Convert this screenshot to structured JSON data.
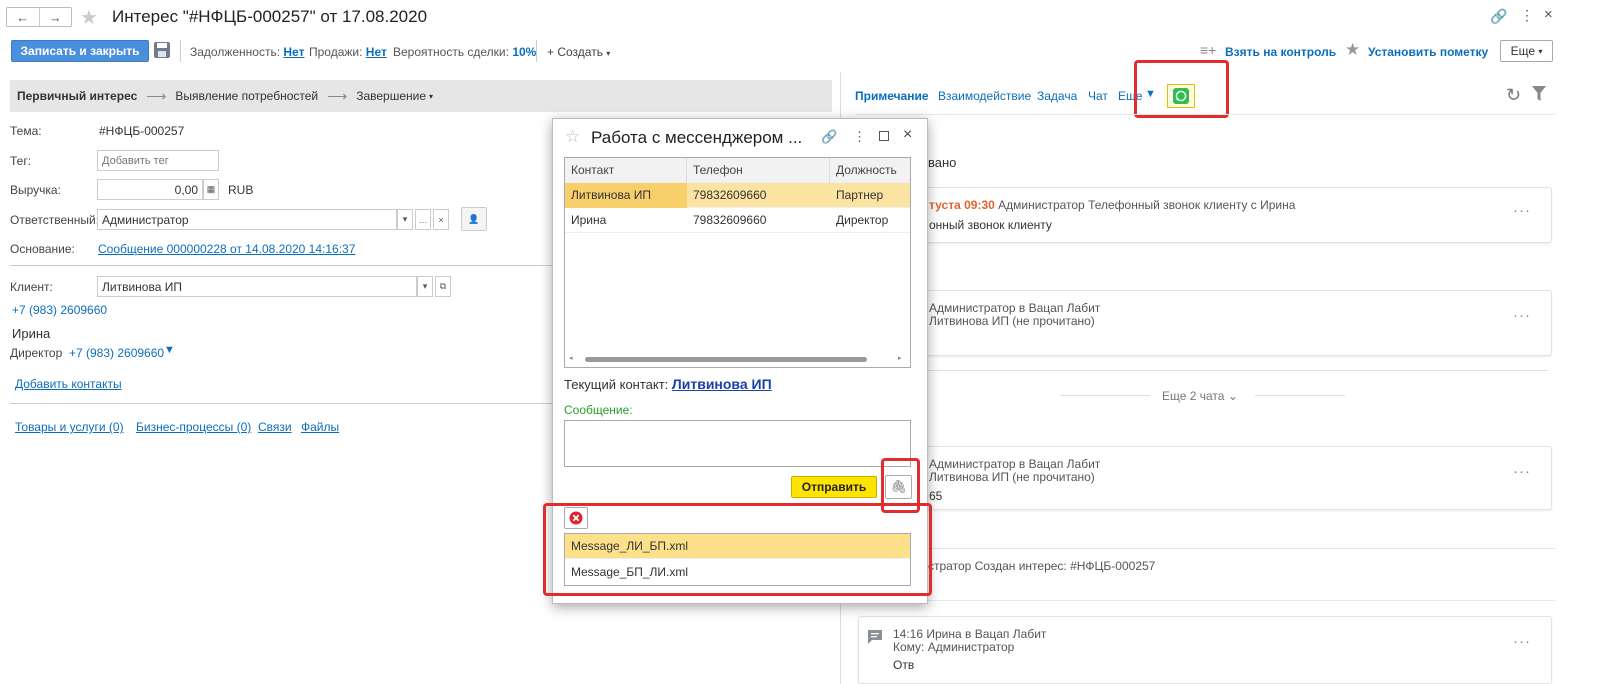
{
  "window": {
    "title": "Интерес \"#НФЦБ-000257\" от 17.08.2020"
  },
  "toolbar": {
    "save_close": "Записать и закрыть",
    "debt_label": "Задолженность:",
    "debt_value": "Нет",
    "sales_label": "Продажи:",
    "sales_value": "Нет",
    "prob_label": "Вероятность сделки:",
    "prob_value": "10%",
    "create": "+ Создать",
    "control": "Взять на контроль",
    "mark": "Установить пометку",
    "more": "Еще"
  },
  "stages": {
    "first": "Первичный интерес",
    "second": "Выявление потребностей",
    "third": "Завершение"
  },
  "form": {
    "topic_label": "Тема:",
    "topic_value": "#НФЦБ-000257",
    "tag_label": "Тег:",
    "tag_placeholder": "Добавить тег",
    "revenue_label": "Выручка:",
    "revenue_value": "0,00",
    "currency": "RUB",
    "resp_label": "Ответственный:",
    "resp_value": "Администратор",
    "basis_label": "Основание:",
    "basis_value": "Сообщение 000000228 от 14.08.2020 14:16:37",
    "client_label": "Клиент:",
    "client_value": "Литвинова ИП",
    "client_phone": "+7 (983) 2609660",
    "contact_name": "Ирина",
    "contact_role": "Директор",
    "contact_phone": "+7 (983) 2609660",
    "add_contacts": "Добавить контакты"
  },
  "bottom_links": [
    "Товары и услуги (0)",
    "Бизнес-процессы (0)",
    "Связи",
    "Файлы"
  ],
  "right": {
    "tabs": [
      "Примечание",
      "Взаимодействие",
      "Задача",
      "Чат",
      "Еще"
    ],
    "section": "вано",
    "item1_time": "туста 09:30",
    "item1_text": "Администратор Телефонный звонок клиенту с Ирина",
    "item1_body": "онный звонок клиенту",
    "item2_line1": "Администратор в Вацап Лабит",
    "item2_line2": "Литвинова ИП (не прочитано)",
    "more_chats": "Еще 2 чата",
    "item3_line1": "Администратор в Вацап Лабит",
    "item3_line2": "Литвинова ИП (не прочитано)",
    "item3_body": "65",
    "item4_text": "стратор Создан интерес: #НФЦБ-000257",
    "item5_line1": "14:16 Ирина в Вацап Лабит",
    "item5_line2": "Кому: Администратор",
    "item5_body": "Отв"
  },
  "dialog": {
    "title": "Работа с мессенджером ...",
    "columns": [
      "Контакт",
      "Телефон",
      "Должность"
    ],
    "rows": [
      {
        "contact": "Литвинова ИП",
        "phone": "79832609660",
        "role": "Партнер"
      },
      {
        "contact": "Ирина",
        "phone": "79832609660",
        "role": "Директор"
      }
    ],
    "current_label": "Текущий контакт:",
    "current_value": "Литвинова ИП",
    "message_label": "Сообщение:",
    "send": "Отправить",
    "files": [
      "Message_ЛИ_БП.xml",
      "Message_БП_ЛИ.xml"
    ]
  },
  "colors": {
    "accent": "#4a8fdd",
    "highlight": "#e02e2e",
    "selected_row": "#fbe3a2",
    "send_button": "#fee400"
  }
}
